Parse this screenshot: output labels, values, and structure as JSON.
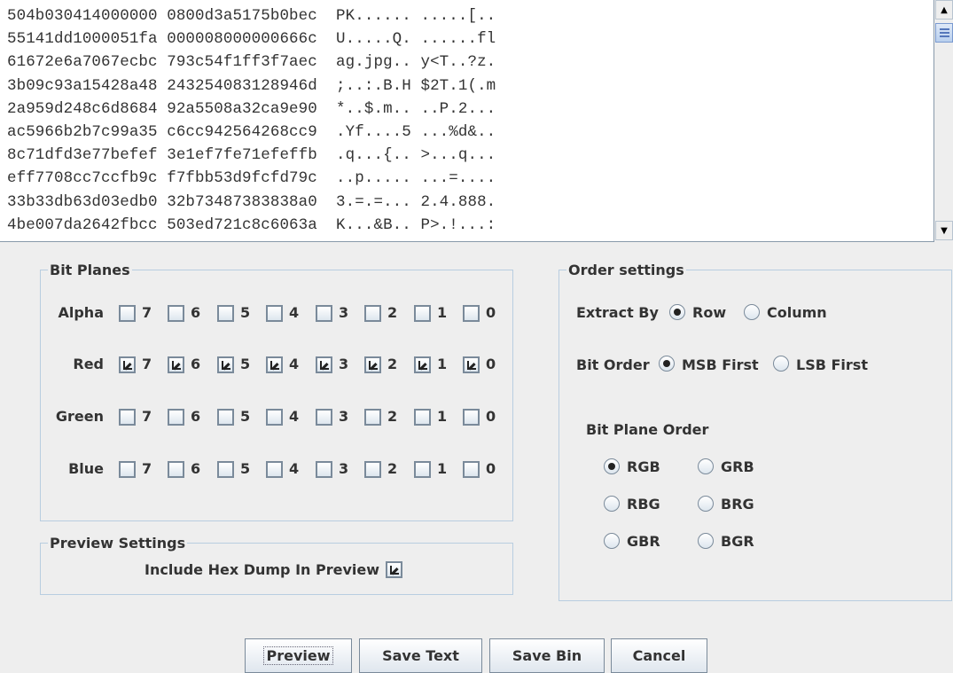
{
  "hex_dump": [
    "504b030414000000 0800d3a5175b0bec  PK...... .....[..",
    "55141dd1000051fa 000008000000666c  U.....Q. ......fl",
    "61672e6a7067ecbc 793c54f1ff3f7aec  ag.jpg.. y<T..?z.",
    "3b09c93a15428a48 243254083128946d  ;..:.B.H $2T.1(.m",
    "2a959d248c6d8684 92a5508a32ca9e90  *..$.m.. ..P.2...",
    "ac5966b2b7c99a35 c6cc942564268cc9  .Yf....5 ...%d&..",
    "8c71dfd3e77befef 3e1ef7fe71efeffb  .q...{.. >...q...",
    "eff7708cc7ccfb9c f7fbb53d9fcfd79c  ..p..... ...=....",
    "33b33db63d03edb0 32b73487383838a0  3.=.=... 2.4.888.",
    "4be007da2642fbcc 503ed721c8c6063a  K...&B.. P>.!...:"
  ],
  "bit_planes": {
    "title": "Bit Planes",
    "bits": [
      "7",
      "6",
      "5",
      "4",
      "3",
      "2",
      "1",
      "0"
    ],
    "rows": [
      {
        "label": "Alpha",
        "checked": [
          false,
          false,
          false,
          false,
          false,
          false,
          false,
          false
        ]
      },
      {
        "label": "Red",
        "checked": [
          true,
          true,
          true,
          true,
          true,
          true,
          true,
          true
        ]
      },
      {
        "label": "Green",
        "checked": [
          false,
          false,
          false,
          false,
          false,
          false,
          false,
          false
        ]
      },
      {
        "label": "Blue",
        "checked": [
          false,
          false,
          false,
          false,
          false,
          false,
          false,
          false
        ]
      }
    ]
  },
  "preview_settings": {
    "title": "Preview Settings",
    "include_hex_label": "Include Hex Dump In Preview",
    "include_hex_checked": true
  },
  "order_settings": {
    "title": "Order settings",
    "extract_by": {
      "label": "Extract By",
      "options": [
        "Row",
        "Column"
      ],
      "selected": 0
    },
    "bit_order": {
      "label": "Bit Order",
      "options": [
        "MSB First",
        "LSB First"
      ],
      "selected": 0
    },
    "bit_plane_order": {
      "label": "Bit Plane Order",
      "options": [
        "RGB",
        "GRB",
        "RBG",
        "BRG",
        "GBR",
        "BGR"
      ],
      "selected": 0
    }
  },
  "buttons": {
    "preview": "Preview",
    "save_text": "Save Text",
    "save_bin": "Save Bin",
    "cancel": "Cancel"
  }
}
